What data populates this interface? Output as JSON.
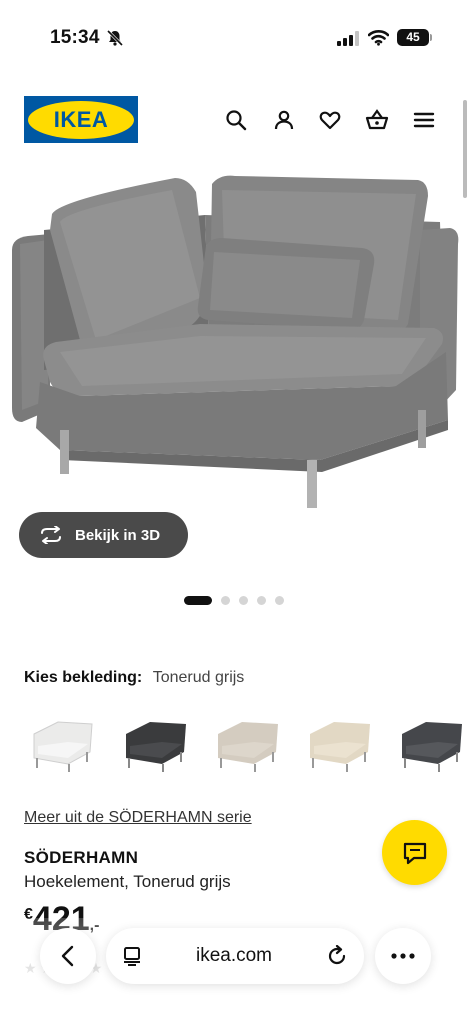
{
  "status_bar": {
    "time": "15:34",
    "battery": "45"
  },
  "header": {
    "logo_text": "IKEA",
    "icons": [
      "search-icon",
      "user-icon",
      "heart-icon",
      "basket-icon",
      "menu-icon"
    ]
  },
  "gallery": {
    "view_3d_label": "Bekijk in 3D",
    "dot_count": 5,
    "active_dot": 0
  },
  "cover": {
    "label": "Kies bekleding:",
    "value": "Tonerud grijs",
    "swatches": [
      {
        "color": "#ebebea"
      },
      {
        "color": "#3a3b3d"
      },
      {
        "color": "#d4ccc0"
      },
      {
        "color": "#e2d8c4"
      },
      {
        "color": "#45474b"
      }
    ]
  },
  "product": {
    "series_link": "Meer uit de SÖDERHAMN serie",
    "name": "SÖDERHAMN",
    "description": "Hoekelement, Tonerud grijs",
    "price_currency": "€",
    "price_amount": "421",
    "price_decimals": ",-"
  },
  "browser": {
    "url": "ikea.com"
  },
  "colors": {
    "ikea_blue": "#0058a3",
    "ikea_yellow": "#ffdb00",
    "button_dark": "#4a4a4a"
  }
}
